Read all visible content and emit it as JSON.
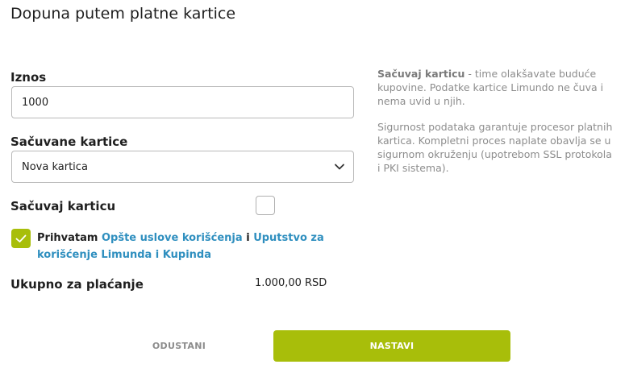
{
  "title": "Dopuna putem platne kartice",
  "amount": {
    "label": "Iznos",
    "value": "1000"
  },
  "saved_cards": {
    "label": "Sačuvane kartice",
    "selected": "Nova kartica"
  },
  "save_card": {
    "label": "Sačuvaj karticu",
    "checked": false
  },
  "terms": {
    "checked": true,
    "prefix": "Prihvatam",
    "link1": "Opšte uslove korišćenja",
    "conjunction": "i",
    "link2": "Uputstvo za korišćenje Limunda i Kupinda"
  },
  "total": {
    "label": "Ukupno za plaćanje",
    "value": "1.000,00 RSD"
  },
  "info": {
    "para1_bold": "Sačuvaj karticu",
    "para1_rest": " - time olakšavate buduće kupovine. Podatke kartice Limundo ne čuva i nema uvid u njih.",
    "para2": "Sigurnost podataka garantuje procesor platnih kartica. Kompletni proces naplate obavlja se u sigurnom okruženju (upotrebom SSL protokola i PKI sistema)."
  },
  "buttons": {
    "cancel": "ODUSTANI",
    "continue": "NASTAVI"
  },
  "colors": {
    "accent": "#a8be0a",
    "link": "#2f8fbf"
  },
  "icons": {
    "select_chevron": "chevron-down-icon",
    "terms_checkbox": "checkmark-icon"
  }
}
